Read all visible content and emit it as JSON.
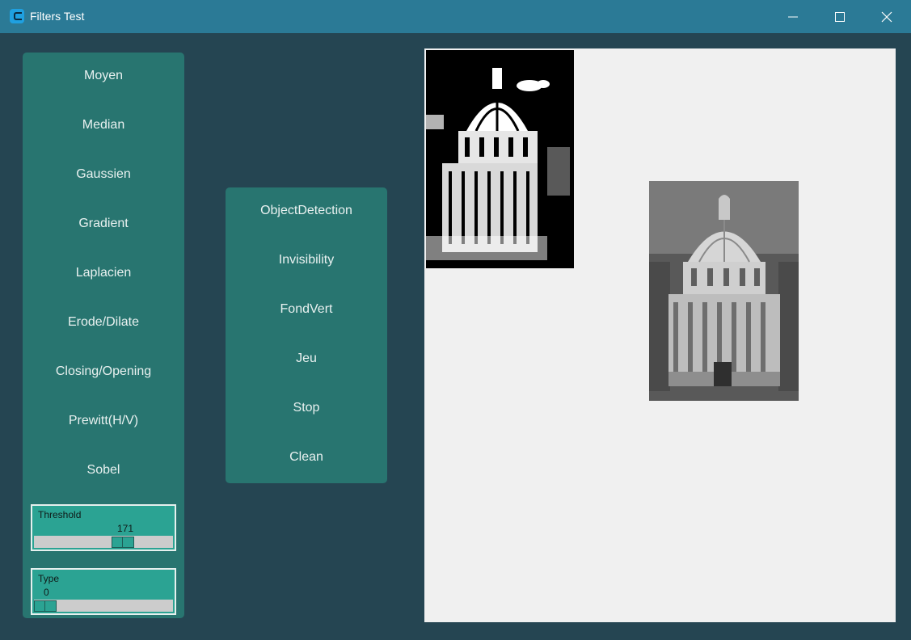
{
  "window": {
    "title": "Filters Test"
  },
  "left_panel": {
    "buttons": [
      "Moyen",
      "Median",
      "Gaussien",
      "Gradient",
      "Laplacien",
      "Erode/Dilate",
      "Closing/Opening",
      "Prewitt(H/V)",
      "Sobel"
    ]
  },
  "middle_panel": {
    "buttons": [
      "ObjectDetection",
      "Invisibility",
      "FondVert",
      "Jeu",
      "Stop",
      "Clean"
    ]
  },
  "sliders": {
    "threshold": {
      "label": "Threshold",
      "value": "171",
      "fraction": 0.67
    },
    "type": {
      "label": "Type",
      "value": "0",
      "fraction": 0.0
    }
  },
  "images": {
    "binary": "binary threshold image of domed building",
    "grayscale": "grayscale photo of domed building"
  }
}
